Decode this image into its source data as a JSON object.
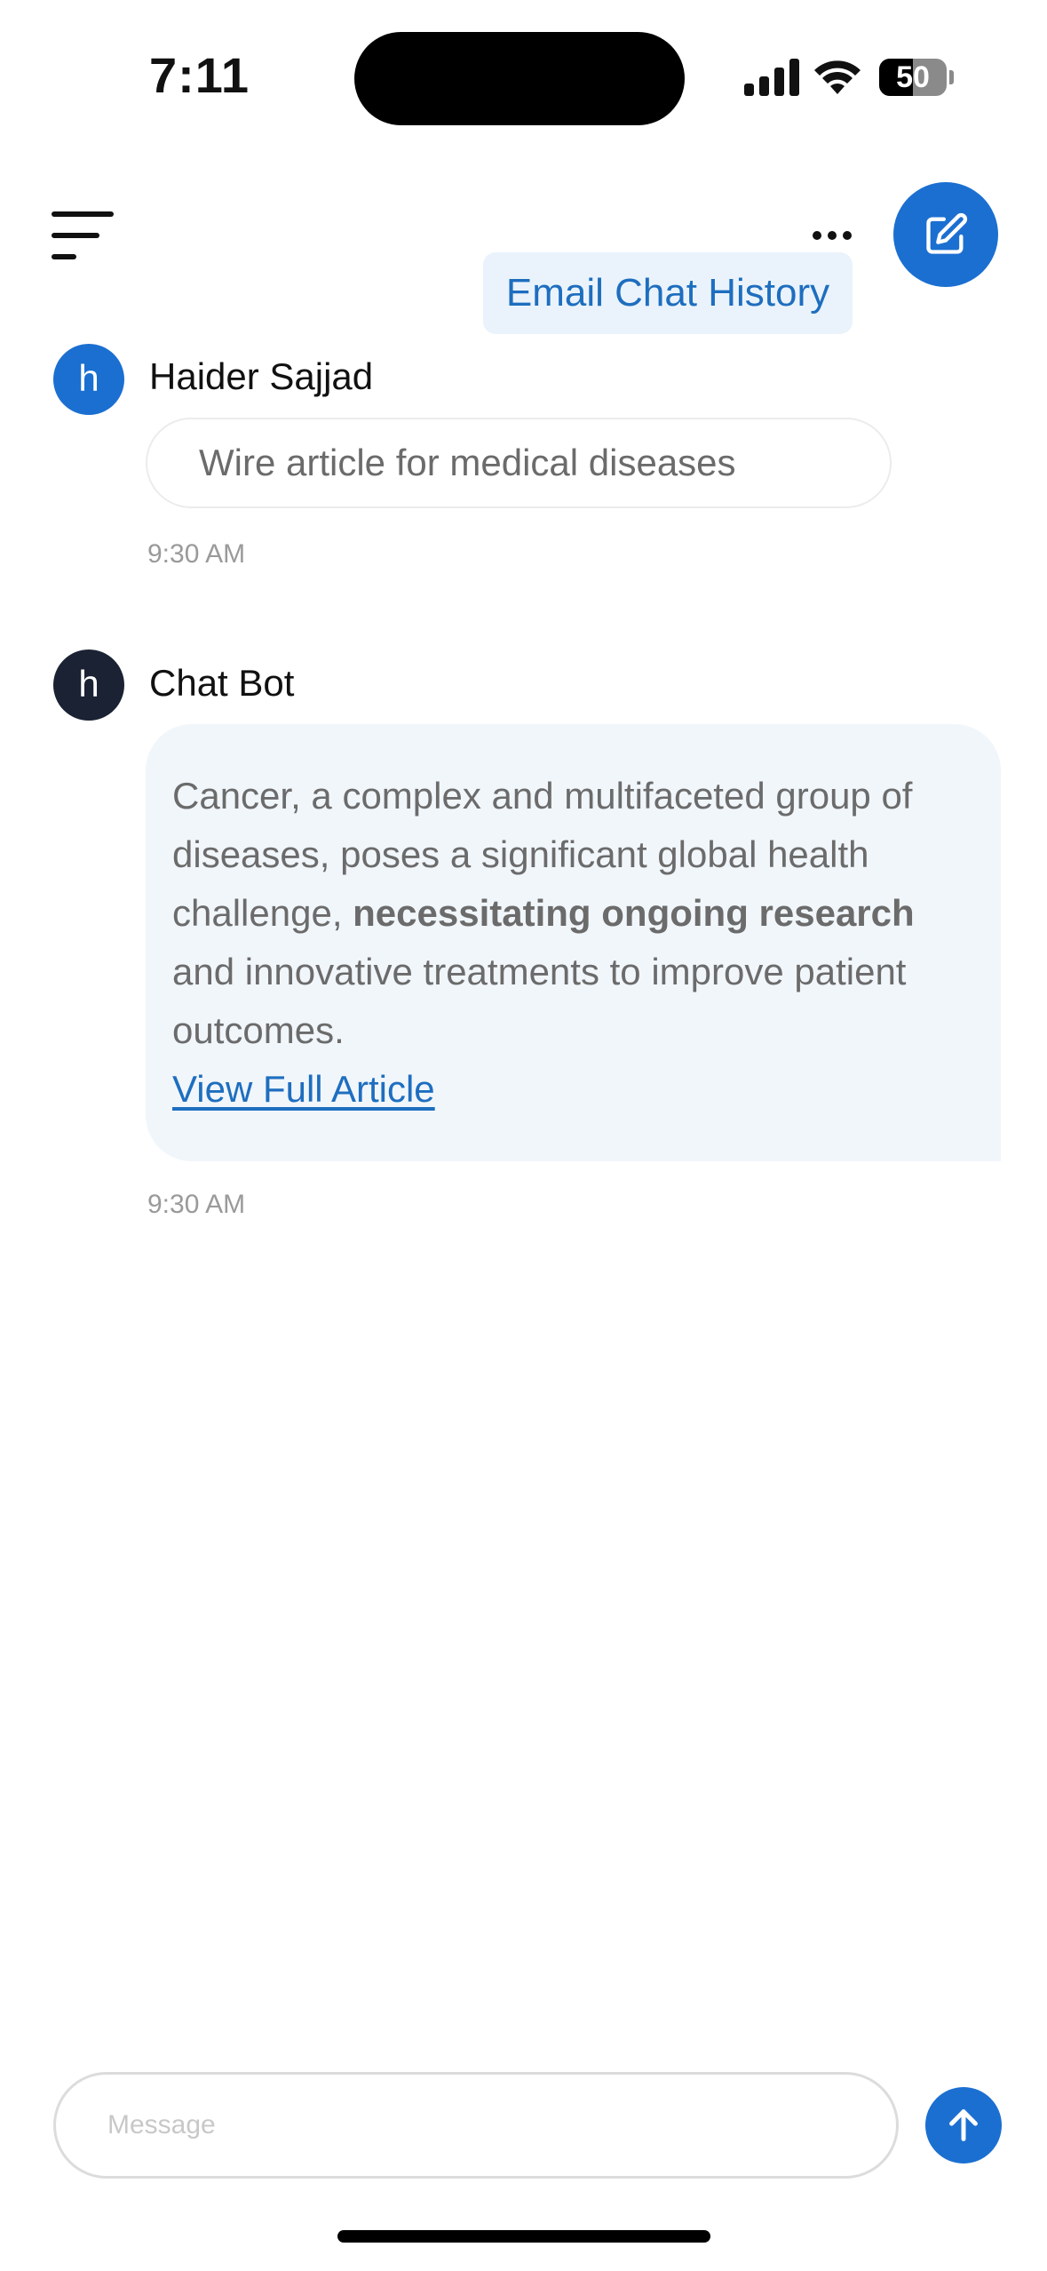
{
  "status_bar": {
    "time": "7:11",
    "battery_level": "50",
    "battery_fraction": 0.5
  },
  "header": {
    "menu_icon": "hamburger-menu-icon",
    "more_icon": "more-dots-icon",
    "compose_icon": "compose-icon",
    "email_history_label": "Email Chat History",
    "accent_color": "#1b6fd1"
  },
  "messages": [
    {
      "sender": "Haider Sajjad",
      "avatar_letter": "h",
      "avatar_color": "#1b6fd1",
      "text": "Wire article for medical diseases",
      "time": "9:30 AM"
    },
    {
      "sender": "Chat Bot",
      "avatar_letter": "h",
      "avatar_color": "#1a2233",
      "text_before": "Cancer, a complex and multifaceted group of diseases, poses a significant global health challenge, ",
      "text_bold": "necessitating ongoing research",
      "text_after": " and innovative treatments to improve patient outcomes.",
      "link_label": "View Full Article",
      "time": "9:30 AM"
    }
  ],
  "composer": {
    "placeholder": "Message",
    "value": "",
    "send_icon": "arrow-up-icon"
  }
}
